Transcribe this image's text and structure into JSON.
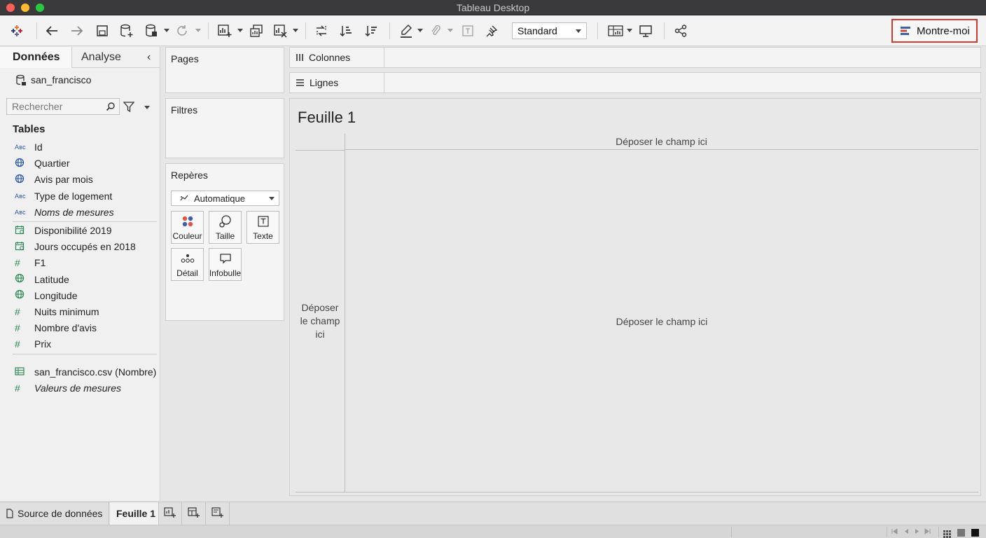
{
  "window": {
    "title": "Tableau Desktop"
  },
  "toolbar": {
    "fit_value": "Standard",
    "show_me_label": "Montre-moi"
  },
  "data_pane": {
    "tabs": {
      "data": "Données",
      "analysis": "Analyse"
    },
    "collapse_glyph": "‹",
    "datasource": "san_francisco",
    "search_placeholder": "Rechercher",
    "tables_heading": "Tables",
    "dimensions": [
      {
        "type": "abc",
        "label": "Id"
      },
      {
        "type": "geo",
        "label": "Quartier"
      },
      {
        "type": "geo",
        "label": "Avis par mois"
      },
      {
        "type": "abc",
        "label": "Type de logement"
      },
      {
        "type": "abc",
        "label": "Noms de mesures"
      }
    ],
    "measures": [
      {
        "type": "date",
        "label": "Disponibilité 2019"
      },
      {
        "type": "date",
        "label": "Jours occupés en 2018"
      },
      {
        "type": "hash",
        "label": "F1"
      },
      {
        "type": "geo",
        "label": "Latitude"
      },
      {
        "type": "geo",
        "label": "Longitude"
      },
      {
        "type": "hash",
        "label": "Nuits minimum"
      },
      {
        "type": "hash",
        "label": "Nombre d'avis"
      },
      {
        "type": "hash",
        "label": "Prix"
      }
    ],
    "extra": [
      {
        "type": "table",
        "label": "san_francisco.csv (Nombre)"
      },
      {
        "type": "hash",
        "label": "Valeurs de mesures"
      }
    ],
    "type_glyphs": {
      "abc": "Aвс",
      "hash": "#"
    }
  },
  "cards": {
    "pages": "Pages",
    "filters": "Filtres",
    "marks": "Repères",
    "marks_type": "Automatique",
    "buttons": {
      "color": "Couleur",
      "size": "Taille",
      "text": "Texte",
      "detail": "Détail",
      "tooltip": "Infobulle"
    }
  },
  "shelves": {
    "columns": "Colonnes",
    "rows": "Lignes"
  },
  "view": {
    "title": "Feuille 1",
    "drop_top": "Déposer le champ ici",
    "drop_left": "Déposer le champ ici",
    "drop_center": "Déposer le champ ici"
  },
  "bottom_tabs": {
    "datasource": "Source de données",
    "sheet": "Feuille 1"
  },
  "colors": {
    "accent_red": "#d63a2f",
    "dimension_blue": "#2b5aa5",
    "measure_green": "#2f8a55"
  }
}
